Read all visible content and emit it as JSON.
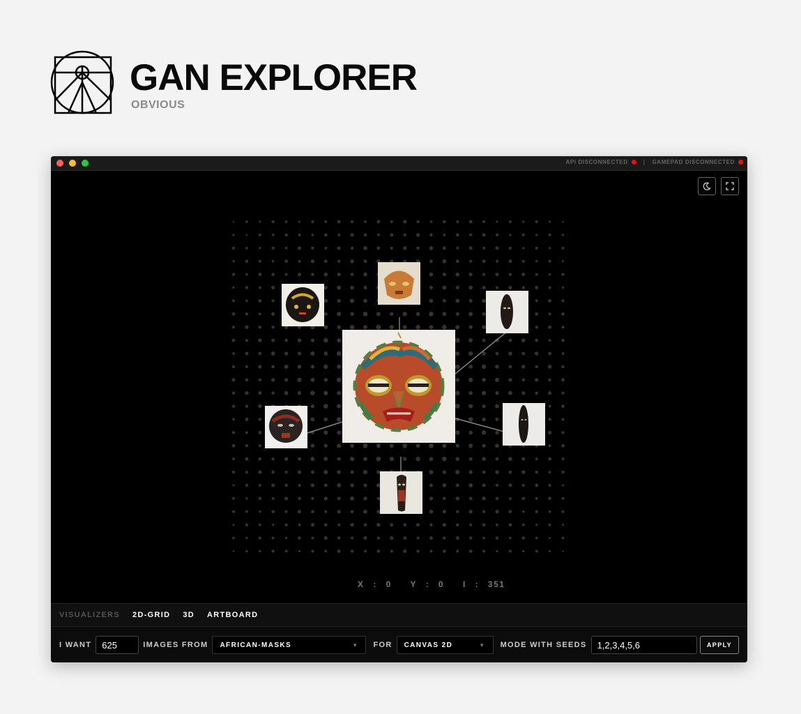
{
  "app": {
    "title": "GAN EXPLORER",
    "subtitle": "OBVIOUS"
  },
  "window": {
    "status": {
      "api": "API DISCONNECTED",
      "separator": "|",
      "gamepad": "GAMEPAD DISCONNECTED",
      "indicator_color": "#e81010"
    }
  },
  "toolbar": {
    "icons": [
      "night-mode-icon",
      "fullscreen-icon"
    ]
  },
  "coords": {
    "x": "X : 0",
    "y": "Y : 0",
    "i": "I : 351"
  },
  "visualizers": {
    "label": "VISUALIZERS",
    "tabs": [
      "2D-GRID",
      "3D",
      "ARTBOARD"
    ]
  },
  "controls": {
    "want_label": "I WANT",
    "count": "625",
    "images_from_label": "IMAGES FROM",
    "dataset": "AFRICAN-MASKS",
    "for_label": "FOR",
    "renderer": "CANVAS 2D",
    "seeds_label": "MODE WITH SEEDS",
    "seeds": "1,2,3,4,5,6",
    "apply": "APPLY"
  },
  "images": {
    "center": "african-mask-main",
    "neighbors": [
      "mask-top",
      "mask-top-left",
      "mask-top-right",
      "mask-left",
      "mask-right",
      "mask-bottom"
    ]
  }
}
